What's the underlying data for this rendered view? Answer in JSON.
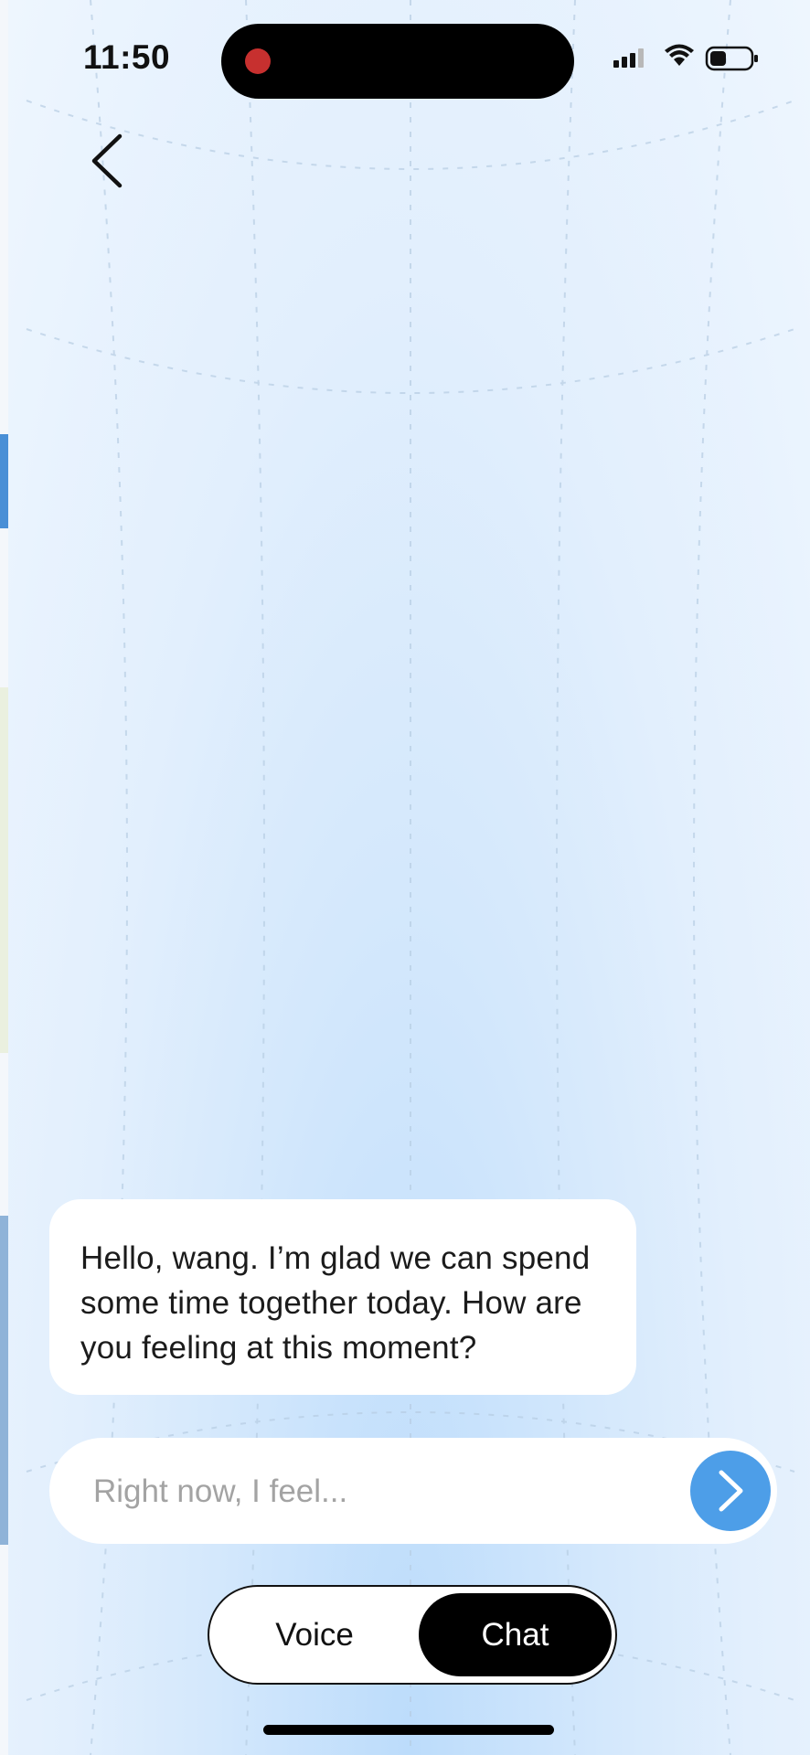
{
  "status_bar": {
    "time": "11:50",
    "icons": [
      "recording-dot-icon",
      "cellular-signal-icon",
      "wifi-icon",
      "battery-icon"
    ]
  },
  "nav": {
    "back_icon": "chevron-left-icon"
  },
  "chat": {
    "messages": [
      {
        "sender": "assistant",
        "lines": [
          "Hello, wang. I’m glad we can spend",
          "some time together today. How are",
          "you feeling at this moment?"
        ]
      }
    ]
  },
  "composer": {
    "placeholder": "Right now, I feel...",
    "value": "",
    "send_icon": "chevron-right-icon"
  },
  "mode_toggle": {
    "options": [
      "Voice",
      "Chat"
    ],
    "selected": "Chat"
  },
  "colors": {
    "accent": "#4d9ee8",
    "recording": "#c7302f",
    "background_top": "#eef6fe",
    "background_bottom": "#bcdcfb"
  }
}
